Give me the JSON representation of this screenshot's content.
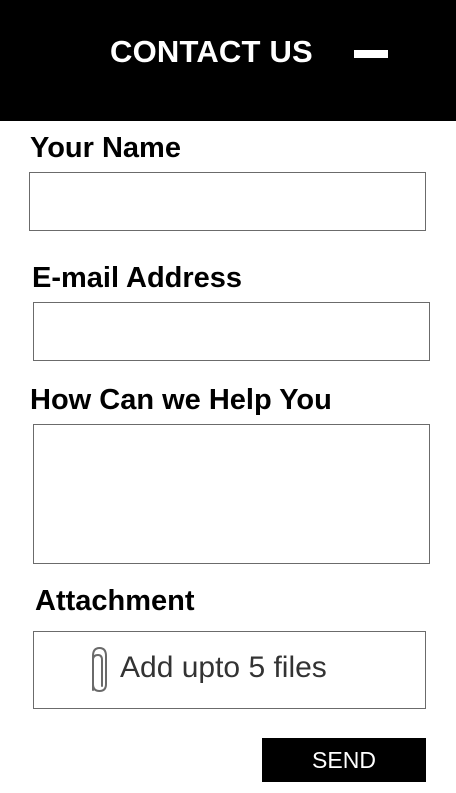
{
  "header": {
    "title": "CONTACT US",
    "minimize_icon": "minus-icon"
  },
  "form": {
    "name_label": "Your Name",
    "name_value": "",
    "email_label": "E-mail Address",
    "email_value": "",
    "help_label": "How Can we Help You",
    "help_value": "",
    "attachment_label": "Attachment",
    "attachment_text": "Add upto 5 files",
    "attachment_icon": "paperclip-icon",
    "send_label": "SEND"
  },
  "colors": {
    "header_background": "#000000",
    "header_text": "#ffffff",
    "button_background": "#000000",
    "button_text": "#ffffff",
    "field_border": "#6b6b6b"
  }
}
